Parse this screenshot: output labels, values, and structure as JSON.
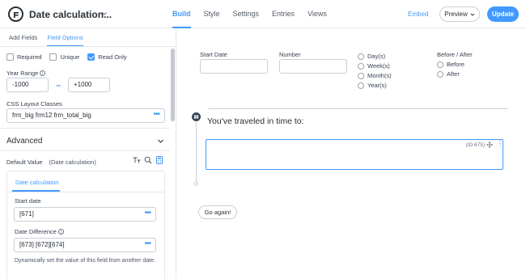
{
  "header": {
    "form_title": "Date calculation...",
    "nav": [
      "Build",
      "Style",
      "Settings",
      "Entries",
      "Views"
    ],
    "active_nav": "Build",
    "embed_label": "Embed",
    "preview_label": "Preview",
    "update_label": "Update",
    "accent_color": "#4199fd"
  },
  "sidebar": {
    "tabs": [
      "Add Fields",
      "Field Options"
    ],
    "active_tab": "Field Options",
    "checkboxes": [
      {
        "label": "Required",
        "checked": false
      },
      {
        "label": "Unique",
        "checked": false
      },
      {
        "label": "Read Only",
        "checked": true
      }
    ],
    "year_range": {
      "label": "Year Range",
      "from": "-1000",
      "dash": "–",
      "to": "+1000"
    },
    "css_classes": {
      "label": "CSS Layout Classes",
      "value": "frm_big frm12 frm_total_big"
    },
    "advanced_label": "Advanced",
    "default_value": {
      "label": "Default Value",
      "type": "(Date calculation)"
    },
    "panel": {
      "tab": "Date calculation",
      "start_date_label": "Start date",
      "start_date_value": "[671]",
      "date_difference_label": "Date Difference",
      "date_difference_value": "[673] [672][674]",
      "help_text": "Dynamically set the value of this field from another date."
    }
  },
  "canvas": {
    "start_date_label": "Start Date",
    "number_label": "Number",
    "units": [
      "Day(s)",
      "Week(s)",
      "Month(s)",
      "Year(s)"
    ],
    "before_after_label": "Before / After",
    "before_after_options": [
      "Before",
      "After"
    ],
    "section_title": "You've traveled in time to:",
    "field_id": "(ID 675)",
    "button_label": "Go again!"
  }
}
